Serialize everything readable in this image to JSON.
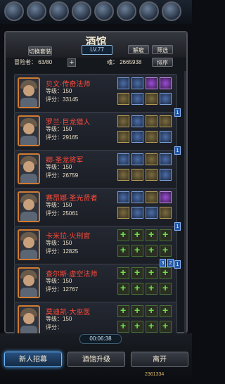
{
  "top_bar": {
    "icons": [
      "skill-icon",
      "equipment-icon",
      "hero-icon",
      "quest-icon",
      "ranking-icon",
      "settings-icon",
      "event-icon",
      "mail-icon"
    ]
  },
  "panel": {
    "title": "酒馆",
    "level": "LV.77"
  },
  "toolbar": {
    "switch_set_label": "切换套装",
    "dismiss_label": "解雇",
    "filter_label": "筛选",
    "sort_label": "排序",
    "adventurer_label": "冒险者：",
    "adventurer_count": "63/80",
    "soul_label": "魂：",
    "soul_value": "2665938"
  },
  "heroes": [
    {
      "name": "贝文·传奇法师",
      "level_label": "等级：",
      "level": "150",
      "score_label": "评分：",
      "score": "33145",
      "slots": [
        "b",
        "b",
        "p",
        "p",
        "g",
        "b",
        "g",
        "b"
      ],
      "flag": ""
    },
    {
      "name": "罗兰·巨龙猎人",
      "level_label": "等级：",
      "level": "150",
      "score_label": "评分：",
      "score": "29165",
      "slots": [
        "g",
        "b",
        "g",
        "g",
        "g",
        "b",
        "g",
        "b"
      ],
      "flag": "1"
    },
    {
      "name": "卿·圣龙将军",
      "level_label": "等级：",
      "level": "150",
      "score_label": "评分：",
      "score": "26759",
      "slots": [
        "b",
        "b",
        "g",
        "b",
        "g",
        "g",
        "g",
        "b"
      ],
      "flag": "1"
    },
    {
      "name": "赛昂娜·圣光贤者",
      "level_label": "等级：",
      "level": "150",
      "score_label": "评分：",
      "score": "25061",
      "slots": [
        "b",
        "b",
        "g",
        "p",
        "g",
        "b",
        "b",
        "g"
      ],
      "flag": ""
    },
    {
      "name": "卡米拉·火刑官",
      "level_label": "等级：",
      "level": "150",
      "score_label": "评分：",
      "score": "12825",
      "slots": [
        "e",
        "e",
        "e",
        "e",
        "e",
        "e",
        "e",
        "e"
      ],
      "flag": "1"
    },
    {
      "name": "查尔斯·虚空法师",
      "level_label": "等级：",
      "level": "150",
      "score_label": "评分：",
      "score": "12767",
      "slots": [
        "e",
        "e",
        "e",
        "e",
        "e",
        "e",
        "e",
        "e"
      ],
      "flag": "1"
    },
    {
      "name": "莫迪凯·大巫医",
      "level_label": "等级：",
      "level": "150",
      "score_label": "评分：",
      "score": "",
      "slots": [
        "e",
        "e",
        "e",
        "e",
        "e",
        "e",
        "e",
        "e"
      ],
      "flag": ""
    }
  ],
  "group_badges": [
    "3",
    "2"
  ],
  "footer": {
    "timer": "00:06:38",
    "recruit_label": "新人招募",
    "upgrade_label": "酒馆升级",
    "leave_label": "离开",
    "gold": "2361334"
  },
  "colors": {
    "hero_name": "#ff4a3a",
    "accent": "#4fa9ff",
    "portrait_border": "#d07b32"
  }
}
